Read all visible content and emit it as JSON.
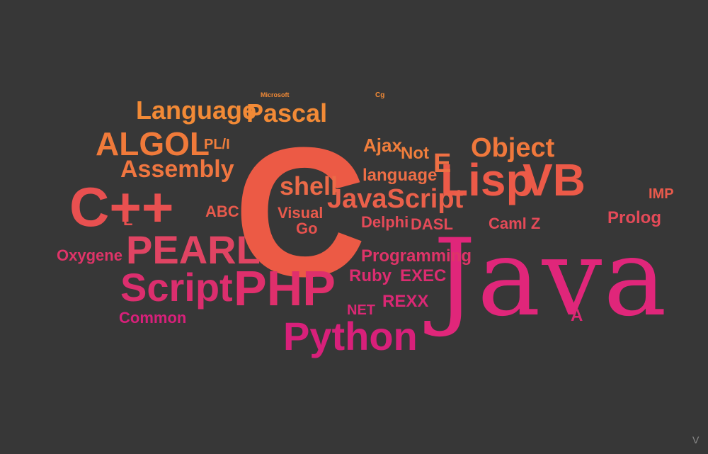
{
  "words": [
    "Java",
    "C",
    "PHP",
    "Python",
    "PEARL",
    "C++",
    "Script",
    "Lisp",
    "VB",
    "ALGOL",
    "Language",
    "Pascal",
    "Assembly",
    "Object",
    "JavaScript",
    "shell",
    "Ajax",
    "Not",
    "E",
    "language",
    "Visual",
    "Go",
    "Delphi",
    "DASL",
    "Caml Z",
    "Prolog",
    "Programming",
    "Oxygene",
    "Ruby",
    "EXEC",
    "REXX",
    "NET",
    "ABC",
    "Common",
    "PL/I",
    "IMP",
    "A",
    "L",
    "Microsoft",
    "Cg"
  ],
  "colors": {
    "background": "#373737",
    "top": "#f08a34",
    "mid": "#e85a4a",
    "bottom": "#d81e78"
  },
  "corner_mark": "V"
}
